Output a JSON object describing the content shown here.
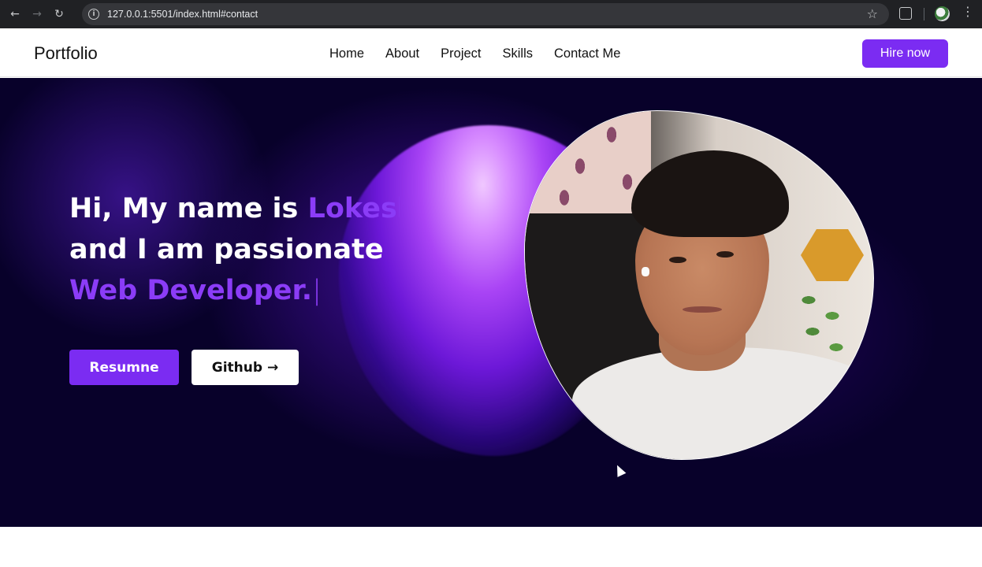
{
  "browser": {
    "url": "127.0.0.1:5501/index.html#contact",
    "icons": [
      "back-icon",
      "forward-icon",
      "reload-icon",
      "site-info-icon",
      "bookmark-star-icon",
      "extensions-icon",
      "profile-avatar",
      "menu-icon"
    ]
  },
  "navbar": {
    "brand": "Portfolio",
    "links": [
      "Home",
      "About",
      "Project",
      "Skills",
      "Contact Me"
    ],
    "cta": "Hire now"
  },
  "hero": {
    "line1_prefix": "Hi, My name is ",
    "line1_name": "Lokesh",
    "line2": "and I am passionate",
    "line3_role": "Web Developer.",
    "typing_cursor": "|",
    "resume_button": "Resumne",
    "github_button": "Github",
    "github_arrow": "→"
  },
  "colors": {
    "accent": "#7b2cf2",
    "hero_bg": "#08012a",
    "text_light": "#ffffff"
  }
}
